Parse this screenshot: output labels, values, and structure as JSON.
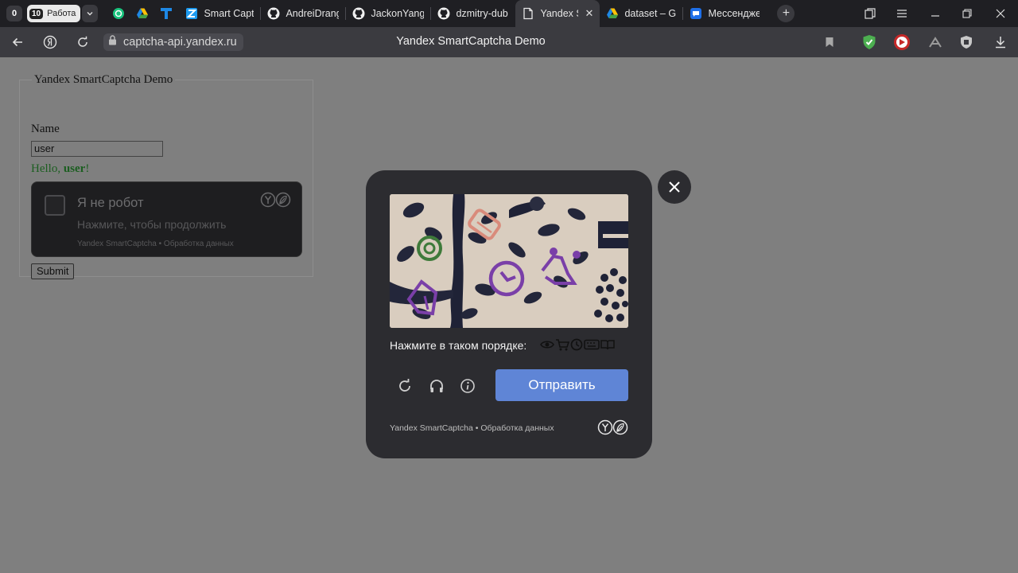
{
  "browser": {
    "tab_counter_zero": "0",
    "workspace": {
      "count": "10",
      "label": "Работа"
    },
    "tabs": [
      {
        "title": "",
        "icon": "chatgpt-icon"
      },
      {
        "title": "",
        "icon": "google-drive-icon"
      },
      {
        "title": "",
        "icon": "trello-icon"
      },
      {
        "title": "Smart Captc",
        "icon": "zed-icon"
      },
      {
        "title": "AndreiDrang",
        "icon": "github-icon"
      },
      {
        "title": "JackonYang",
        "icon": "github-icon"
      },
      {
        "title": "dzmitry-dub",
        "icon": "github-icon"
      },
      {
        "title": "Yandex Sm",
        "icon": "document-icon",
        "active": true
      },
      {
        "title": "dataset – Go",
        "icon": "google-drive-icon"
      },
      {
        "title": "Мессендже",
        "icon": "messenger-icon"
      }
    ],
    "url": "captcha-api.yandex.ru",
    "page_title": "Yandex SmartCaptcha Demo"
  },
  "page": {
    "legend": "Yandex SmartCaptcha Demo",
    "name_label": "Name",
    "name_value": "user",
    "hello_prefix": "Hello, ",
    "hello_user": "user",
    "hello_suffix": "!",
    "widget": {
      "title": "Я не робот",
      "subtitle": "Нажмите, чтобы продолжить",
      "footer": "Yandex SmartCaptcha • Обработка данных"
    },
    "submit_label": "Submit"
  },
  "captcha_modal": {
    "instruction": "Нажмите в таком порядке:",
    "sequence_icons": [
      "eye-icon",
      "cart-icon",
      "clock-icon",
      "keyboard-icon",
      "book-icon"
    ],
    "submit_label": "Отправить",
    "footer": "Yandex SmartCaptcha • Обработка данных",
    "colors": {
      "accent": "#5f85d6",
      "panel": "#2c2c30",
      "shape_purple": "#7a3fa8",
      "shape_green": "#3e7a3a",
      "shape_salmon": "#d98b7b"
    }
  }
}
